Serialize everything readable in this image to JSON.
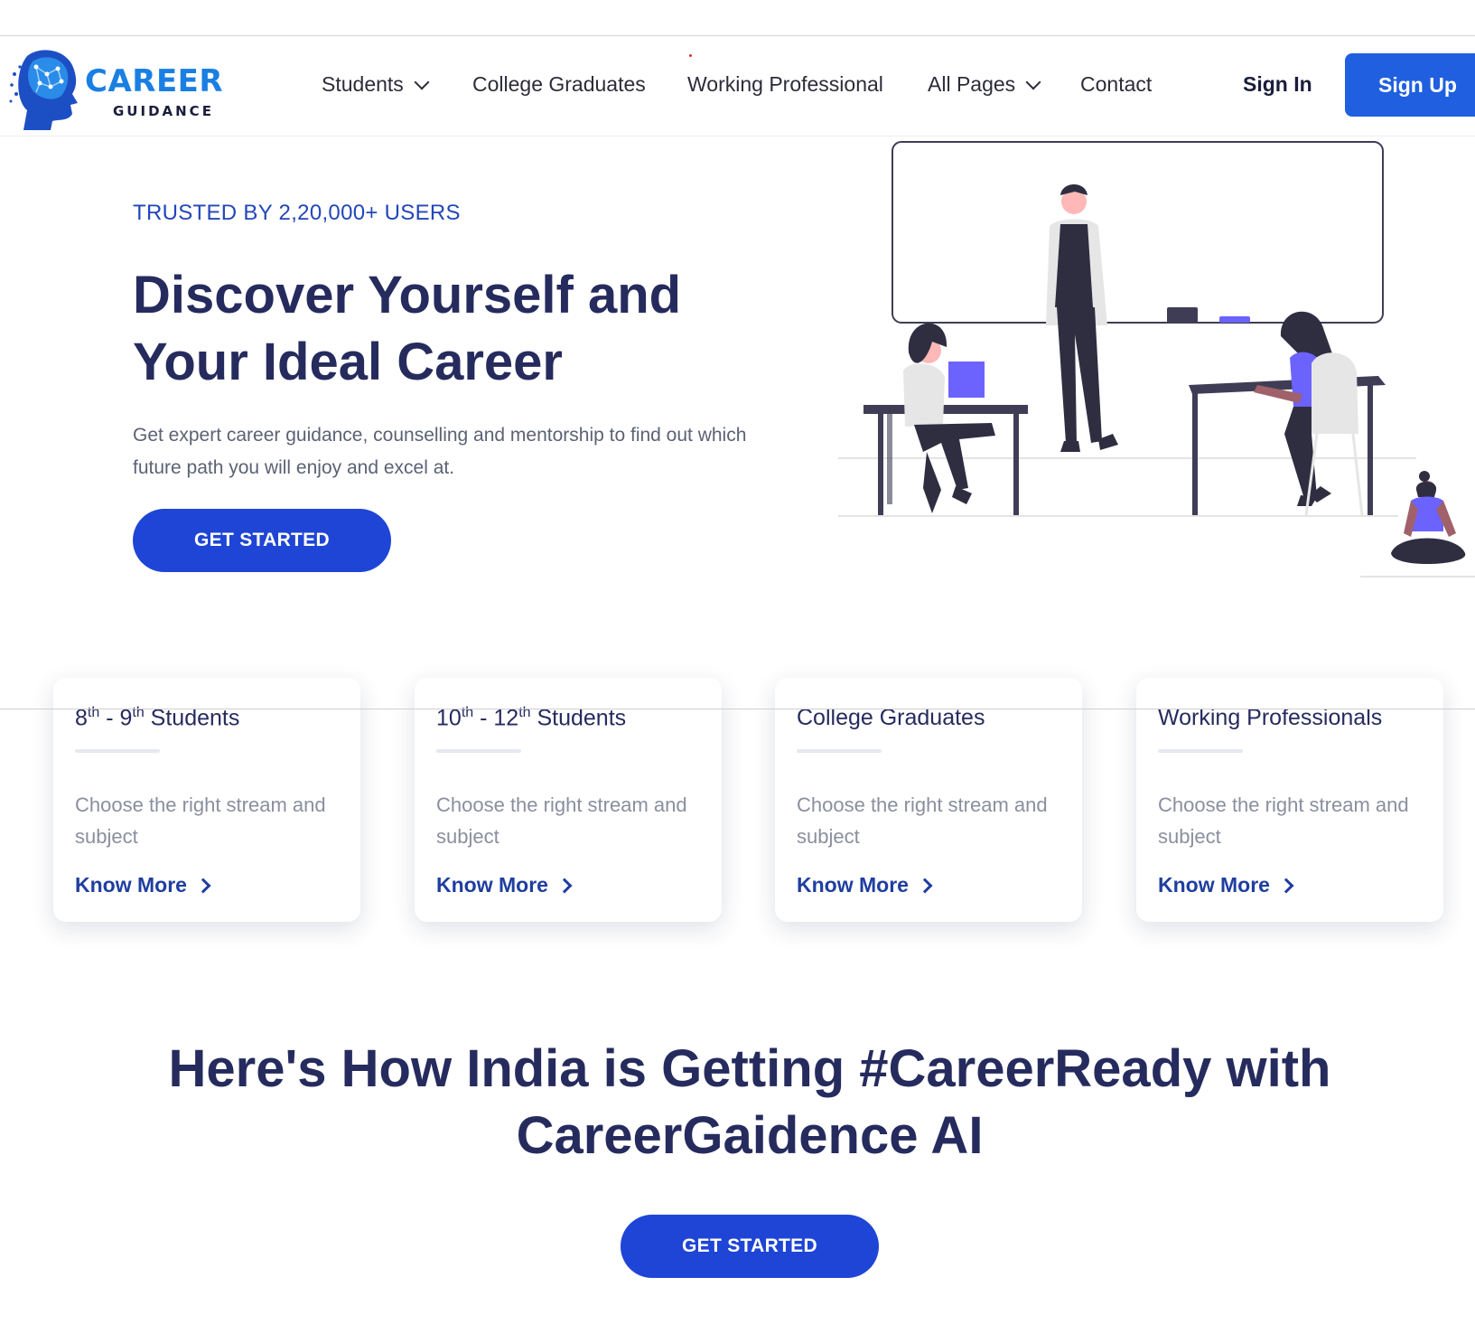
{
  "header": {
    "logo": {
      "word": "CAREER",
      "sub": "GUIDANCE",
      "icon": "brain-head-icon"
    },
    "nav": [
      {
        "label": "Students",
        "dropdown": true
      },
      {
        "label": "College Graduates",
        "dropdown": false
      },
      {
        "label": "Working Professional",
        "dropdown": false
      },
      {
        "label": "All Pages",
        "dropdown": true
      },
      {
        "label": "Contact",
        "dropdown": false
      }
    ],
    "sign_in": "Sign In",
    "sign_up": "Sign Up"
  },
  "hero": {
    "trusted": "TRUSTED BY 2,20,000+ USERS",
    "title_line1": "Discover Yourself and",
    "title_line2": "Your Ideal Career",
    "description": "Get expert career guidance, counselling and mentorship to find out which future path you will enjoy and excel at.",
    "cta": "GET STARTED"
  },
  "cards": [
    {
      "title_a": "8",
      "sup_a": "th",
      "title_b": " - 9",
      "sup_b": "th",
      "title_c": " Students",
      "text": "Choose the right stream and subject",
      "link": "Know More"
    },
    {
      "title_a": "10",
      "sup_a": "th",
      "title_b": " - 12",
      "sup_b": "th",
      "title_c": " Students",
      "text": "Choose the right stream and subject",
      "link": "Know More"
    },
    {
      "title": "College Graduates",
      "text": "Choose the right stream and subject",
      "link": "Know More"
    },
    {
      "title": "Working Professionals",
      "text": "Choose the right stream and subject",
      "link": "Know More"
    }
  ],
  "section": {
    "title_line1": "Here's How India is Getting #CareerReady with",
    "title_line2": "CareerGaidence AI",
    "cta": "GET STARTED"
  },
  "colors": {
    "primary": "#1e45d6",
    "signup": "#1f5fe0",
    "heading": "#262b5e",
    "accent_purple": "#6c63ff"
  }
}
